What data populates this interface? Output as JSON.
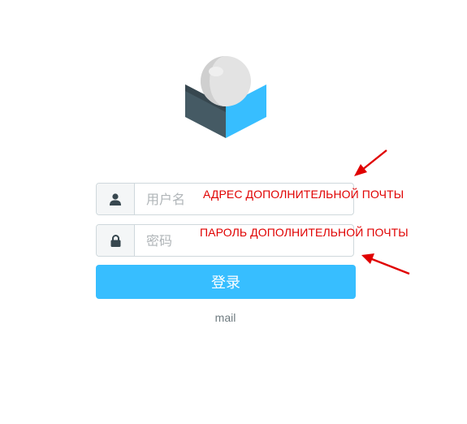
{
  "form": {
    "username_placeholder": "用户名",
    "password_placeholder": "密码",
    "login_label": "登录"
  },
  "footer": {
    "text": "mail"
  },
  "annotations": {
    "username_note": "АДРЕС ДОПОЛНИТЕЛЬНОЙ ПОЧТЫ",
    "password_note": "ПАРОЛЬ ДОПОЛНИТЕЛЬНОЙ ПОЧТЫ"
  },
  "icons": {
    "username": "user-icon",
    "password": "lock-icon",
    "logo": "roundcube-logo"
  },
  "colors": {
    "accent": "#37beff",
    "logo_dark": "#455a64",
    "annotation": "#e00000"
  }
}
